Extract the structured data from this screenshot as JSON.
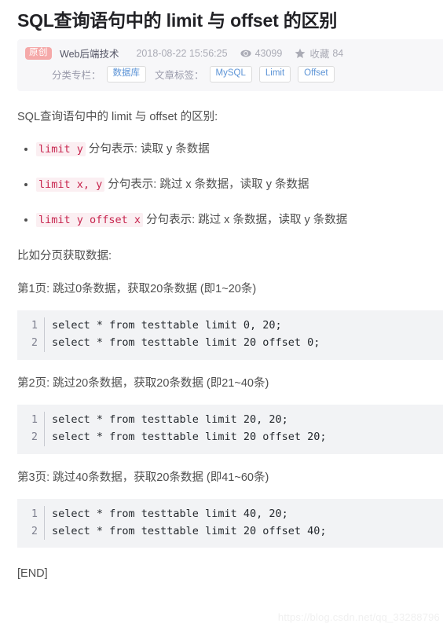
{
  "article": {
    "title": "SQL查询语句中的 limit 与 offset 的区别",
    "meta": {
      "badge": "原创",
      "author": "Web后端技术",
      "date": "2018-08-22 15:56:25",
      "views_icon": "eye-icon",
      "views": "43099",
      "favorite_icon": "star-icon",
      "favorite_label": "收藏",
      "favorite_count": "84"
    },
    "tags": {
      "column_label": "分类专栏：",
      "column_value": "数据库",
      "tags_label": "文章标签：",
      "tag_items": [
        "MySQL",
        "Limit",
        "Offset"
      ]
    },
    "body": {
      "intro": "SQL查询语句中的 limit 与 offset 的区别:",
      "bullets": [
        {
          "code": "limit y",
          "text": " 分句表示: 读取 y 条数据"
        },
        {
          "code": "limit x, y",
          "text": " 分句表示: 跳过 x 条数据，读取 y 条数据"
        },
        {
          "code": "limit y offset x",
          "text": " 分句表示: 跳过 x 条数据，读取 y 条数据"
        }
      ],
      "paging_intro": "比如分页获取数据:",
      "pages": [
        {
          "label": "第1页:  跳过0条数据，获取20条数据 (即1~20条)",
          "lines": [
            {
              "no": "1",
              "code": "select * from testtable limit 0, 20;"
            },
            {
              "no": "2",
              "code": "select * from testtable limit 20 offset 0;"
            }
          ]
        },
        {
          "label": "第2页:  跳过20条数据，获取20条数据 (即21~40条)",
          "lines": [
            {
              "no": "1",
              "code": "select * from testtable limit 20, 20;"
            },
            {
              "no": "2",
              "code": "select * from testtable limit 20 offset 20;"
            }
          ]
        },
        {
          "label": "第3页:  跳过40条数据，获取20条数据 (即41~60条)",
          "lines": [
            {
              "no": "1",
              "code": "select * from testtable limit 40, 20;"
            },
            {
              "no": "2",
              "code": "select * from testtable limit 20 offset 40;"
            }
          ]
        }
      ],
      "end": "[END]"
    },
    "watermark": "https://blog.csdn.net/qq_33288796",
    "colors": {
      "inline_code_text": "#c7254e",
      "inline_code_bg": "#fbeff2",
      "badge_bg": "#f5a9a9",
      "tag_text": "#5b93d6",
      "code_bg": "#f2f3f5",
      "meta_band_bg": "#f7f7f9"
    }
  }
}
